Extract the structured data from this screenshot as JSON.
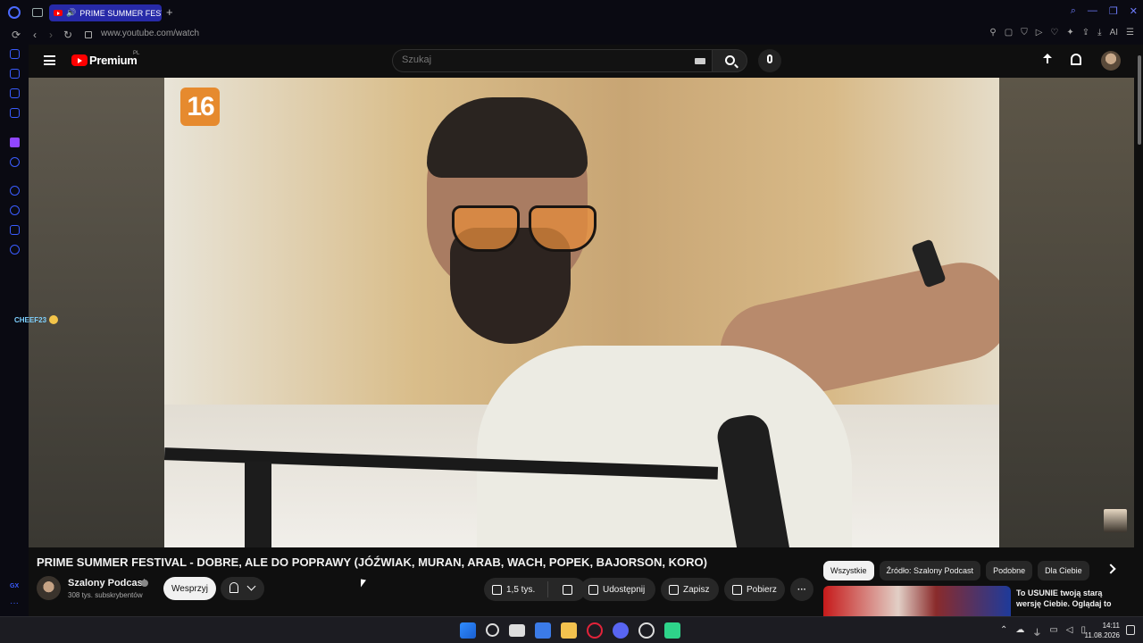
{
  "browser": {
    "tab_title": "PRIME SUMMER FESTIVAL",
    "new_tab": "+",
    "url": "www.youtube.com/watch",
    "nav_back": "‹",
    "nav_forward": "›",
    "nav_reload": "↻",
    "ai_label": "AI"
  },
  "youtube": {
    "brand": "Premium",
    "region": "PL",
    "search_placeholder": "Szukaj"
  },
  "player": {
    "age_rating": "16"
  },
  "overlay": {
    "streamer": "CHEEF23"
  },
  "video": {
    "title": "PRIME SUMMER FESTIVAL - DOBRE, ALE DO POPRAWY (JÓŹWIAK, MURAN, ARAB, WACH, POPEK, BAJORSON, KORO)",
    "channel_name": "Szalony Podcast",
    "subscribers": "308 tys. subskrybentów",
    "support_label": "Wesprzyj",
    "likes": "1,5 tys.",
    "share_label": "Udostępnij",
    "save_label": "Zapisz",
    "download_label": "Pobierz",
    "more_label": "···"
  },
  "recommendations": {
    "chips": [
      "Wszystkie",
      "Źródło: Szalony Podcast",
      "Podobne",
      "Dla Ciebie"
    ],
    "active_chip": 0,
    "first_title": "To USUNIE twoją starą wersję Ciebie. Oglądaj to"
  },
  "taskbar": {
    "time": "14:11",
    "date": "11.08.2026"
  },
  "colors": {
    "youtube_red": "#ff0000",
    "opera_blue": "#3a5cff",
    "active_tab": "#272aa8",
    "age_badge": "#e68a2e"
  }
}
